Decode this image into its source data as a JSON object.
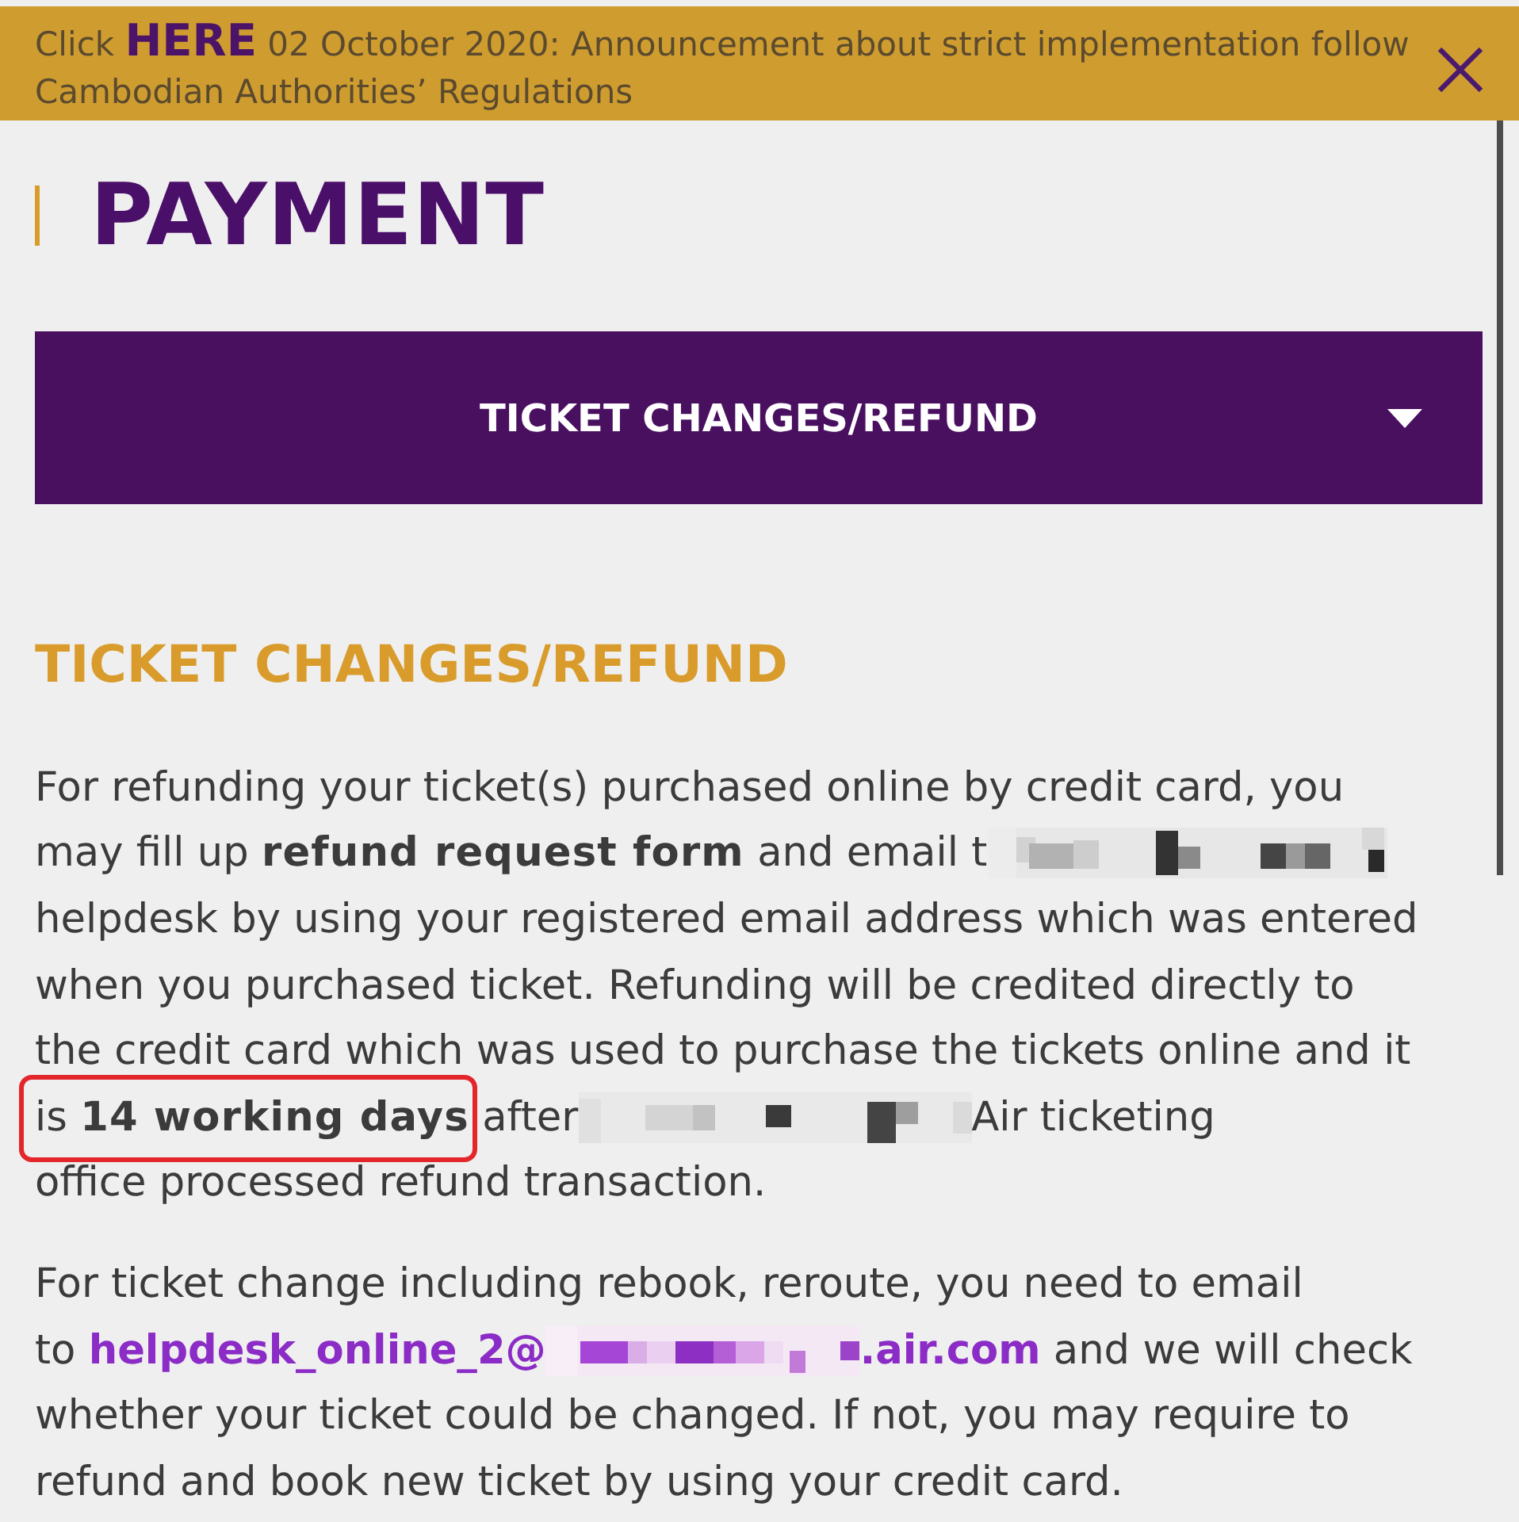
{
  "announcement": {
    "lead": "Click",
    "link": "HERE",
    "text": "02 October 2020: Announcement about strict implementation follow Cambodian Authorities’ Regulations"
  },
  "page_title": "PAYMENT",
  "dropdown": {
    "label": "TICKET CHANGES/REFUND",
    "expanded": false
  },
  "section": {
    "heading": "TICKET CHANGES/REFUND",
    "paragraphs": [
      {
        "highlighted": true,
        "parts": [
          {
            "kind": "text",
            "text": "For refunding your ticket(s) purchased online by credit card, you may fill up **refund request form** and email t"
          },
          {
            "kind": "redacted"
          },
          {
            "kind": "text",
            "text": "helpdesk by using your registered email address which was entered when you purchased ticket. Refunding will be credited directly to the credit card which was used to purchase the tickets online and it is **14 working days** after"
          },
          {
            "kind": "redacted"
          },
          {
            "kind": "text",
            "text": "Air ticketing\noffice processed refund transaction."
          }
        ]
      },
      {
        "highlighted": false,
        "parts": [
          {
            "kind": "text",
            "text": "For ticket change including rebook, reroute, you need to email"
          },
          {
            "kind": "email",
            "prefix": "to",
            "user": "helpdesk_online_2@",
            "domain": ".air.com"
          },
          {
            "kind": "text",
            "text": "and we will check whether your ticket could be changed. If not, you may require to refund and book new ticket by using your credit card."
          }
        ]
      }
    ]
  }
}
